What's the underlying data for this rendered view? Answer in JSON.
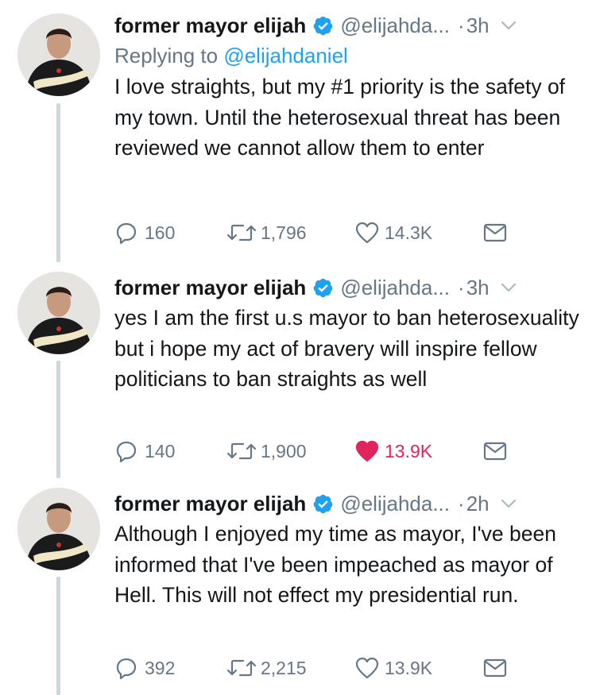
{
  "tweets": [
    {
      "name": "former mayor elijah",
      "handle": "@elijahda...",
      "dot": "·",
      "time": "3h",
      "replying_label": "Replying to ",
      "replying_to": "@elijahdaniel",
      "text": "I love straights, but my #1 priority is the safety of my town. Until the heterosexual threat has been reviewed we cannot allow them to enter",
      "replies": "160",
      "retweets": "1,796",
      "likes": "14.3K",
      "liked": false
    },
    {
      "name": "former mayor elijah",
      "handle": "@elijahda...",
      "dot": "·",
      "time": "3h",
      "text": "yes I am the first u.s mayor to ban heterosexuality but i hope my act of bravery will inspire fellow politicians to ban straights as well",
      "replies": "140",
      "retweets": "1,900",
      "likes": "13.9K",
      "liked": true
    },
    {
      "name": "former mayor elijah",
      "handle": "@elijahda...",
      "dot": "·",
      "time": "2h",
      "text": "Although I enjoyed my time as mayor, I've been informed that I've been impeached as mayor of Hell. This will not effect my presidential run.",
      "replies": "392",
      "retweets": "2,215",
      "likes": "13.9K",
      "liked": false
    }
  ],
  "colors": {
    "text": "#14171a",
    "secondary": "#657786",
    "link": "#1da1f2",
    "verified": "#1da1f2",
    "like_active": "#e0245e",
    "thread_line": "#ccd6dd"
  },
  "icons": [
    "verified-badge-icon",
    "chevron-down-icon",
    "reply-icon",
    "retweet-icon",
    "heart-icon",
    "direct-message-icon"
  ]
}
